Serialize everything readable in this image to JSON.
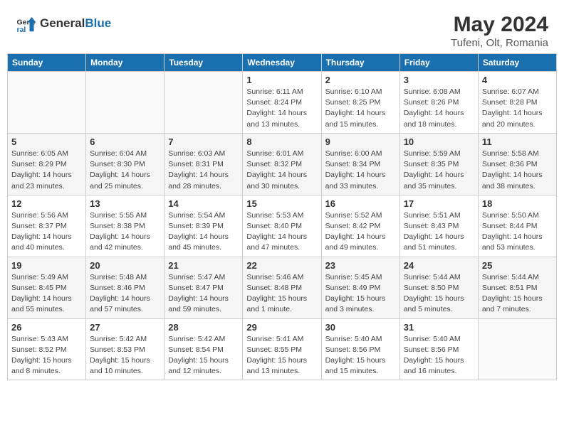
{
  "header": {
    "logo_general": "General",
    "logo_blue": "Blue",
    "title": "May 2024",
    "location": "Tufeni, Olt, Romania"
  },
  "days_of_week": [
    "Sunday",
    "Monday",
    "Tuesday",
    "Wednesday",
    "Thursday",
    "Friday",
    "Saturday"
  ],
  "weeks": [
    [
      {
        "day": "",
        "info": ""
      },
      {
        "day": "",
        "info": ""
      },
      {
        "day": "",
        "info": ""
      },
      {
        "day": "1",
        "info": "Sunrise: 6:11 AM\nSunset: 8:24 PM\nDaylight: 14 hours\nand 13 minutes."
      },
      {
        "day": "2",
        "info": "Sunrise: 6:10 AM\nSunset: 8:25 PM\nDaylight: 14 hours\nand 15 minutes."
      },
      {
        "day": "3",
        "info": "Sunrise: 6:08 AM\nSunset: 8:26 PM\nDaylight: 14 hours\nand 18 minutes."
      },
      {
        "day": "4",
        "info": "Sunrise: 6:07 AM\nSunset: 8:28 PM\nDaylight: 14 hours\nand 20 minutes."
      }
    ],
    [
      {
        "day": "5",
        "info": "Sunrise: 6:05 AM\nSunset: 8:29 PM\nDaylight: 14 hours\nand 23 minutes."
      },
      {
        "day": "6",
        "info": "Sunrise: 6:04 AM\nSunset: 8:30 PM\nDaylight: 14 hours\nand 25 minutes."
      },
      {
        "day": "7",
        "info": "Sunrise: 6:03 AM\nSunset: 8:31 PM\nDaylight: 14 hours\nand 28 minutes."
      },
      {
        "day": "8",
        "info": "Sunrise: 6:01 AM\nSunset: 8:32 PM\nDaylight: 14 hours\nand 30 minutes."
      },
      {
        "day": "9",
        "info": "Sunrise: 6:00 AM\nSunset: 8:34 PM\nDaylight: 14 hours\nand 33 minutes."
      },
      {
        "day": "10",
        "info": "Sunrise: 5:59 AM\nSunset: 8:35 PM\nDaylight: 14 hours\nand 35 minutes."
      },
      {
        "day": "11",
        "info": "Sunrise: 5:58 AM\nSunset: 8:36 PM\nDaylight: 14 hours\nand 38 minutes."
      }
    ],
    [
      {
        "day": "12",
        "info": "Sunrise: 5:56 AM\nSunset: 8:37 PM\nDaylight: 14 hours\nand 40 minutes."
      },
      {
        "day": "13",
        "info": "Sunrise: 5:55 AM\nSunset: 8:38 PM\nDaylight: 14 hours\nand 42 minutes."
      },
      {
        "day": "14",
        "info": "Sunrise: 5:54 AM\nSunset: 8:39 PM\nDaylight: 14 hours\nand 45 minutes."
      },
      {
        "day": "15",
        "info": "Sunrise: 5:53 AM\nSunset: 8:40 PM\nDaylight: 14 hours\nand 47 minutes."
      },
      {
        "day": "16",
        "info": "Sunrise: 5:52 AM\nSunset: 8:42 PM\nDaylight: 14 hours\nand 49 minutes."
      },
      {
        "day": "17",
        "info": "Sunrise: 5:51 AM\nSunset: 8:43 PM\nDaylight: 14 hours\nand 51 minutes."
      },
      {
        "day": "18",
        "info": "Sunrise: 5:50 AM\nSunset: 8:44 PM\nDaylight: 14 hours\nand 53 minutes."
      }
    ],
    [
      {
        "day": "19",
        "info": "Sunrise: 5:49 AM\nSunset: 8:45 PM\nDaylight: 14 hours\nand 55 minutes."
      },
      {
        "day": "20",
        "info": "Sunrise: 5:48 AM\nSunset: 8:46 PM\nDaylight: 14 hours\nand 57 minutes."
      },
      {
        "day": "21",
        "info": "Sunrise: 5:47 AM\nSunset: 8:47 PM\nDaylight: 14 hours\nand 59 minutes."
      },
      {
        "day": "22",
        "info": "Sunrise: 5:46 AM\nSunset: 8:48 PM\nDaylight: 15 hours\nand 1 minute."
      },
      {
        "day": "23",
        "info": "Sunrise: 5:45 AM\nSunset: 8:49 PM\nDaylight: 15 hours\nand 3 minutes."
      },
      {
        "day": "24",
        "info": "Sunrise: 5:44 AM\nSunset: 8:50 PM\nDaylight: 15 hours\nand 5 minutes."
      },
      {
        "day": "25",
        "info": "Sunrise: 5:44 AM\nSunset: 8:51 PM\nDaylight: 15 hours\nand 7 minutes."
      }
    ],
    [
      {
        "day": "26",
        "info": "Sunrise: 5:43 AM\nSunset: 8:52 PM\nDaylight: 15 hours\nand 8 minutes."
      },
      {
        "day": "27",
        "info": "Sunrise: 5:42 AM\nSunset: 8:53 PM\nDaylight: 15 hours\nand 10 minutes."
      },
      {
        "day": "28",
        "info": "Sunrise: 5:42 AM\nSunset: 8:54 PM\nDaylight: 15 hours\nand 12 minutes."
      },
      {
        "day": "29",
        "info": "Sunrise: 5:41 AM\nSunset: 8:55 PM\nDaylight: 15 hours\nand 13 minutes."
      },
      {
        "day": "30",
        "info": "Sunrise: 5:40 AM\nSunset: 8:56 PM\nDaylight: 15 hours\nand 15 minutes."
      },
      {
        "day": "31",
        "info": "Sunrise: 5:40 AM\nSunset: 8:56 PM\nDaylight: 15 hours\nand 16 minutes."
      },
      {
        "day": "",
        "info": ""
      }
    ]
  ]
}
